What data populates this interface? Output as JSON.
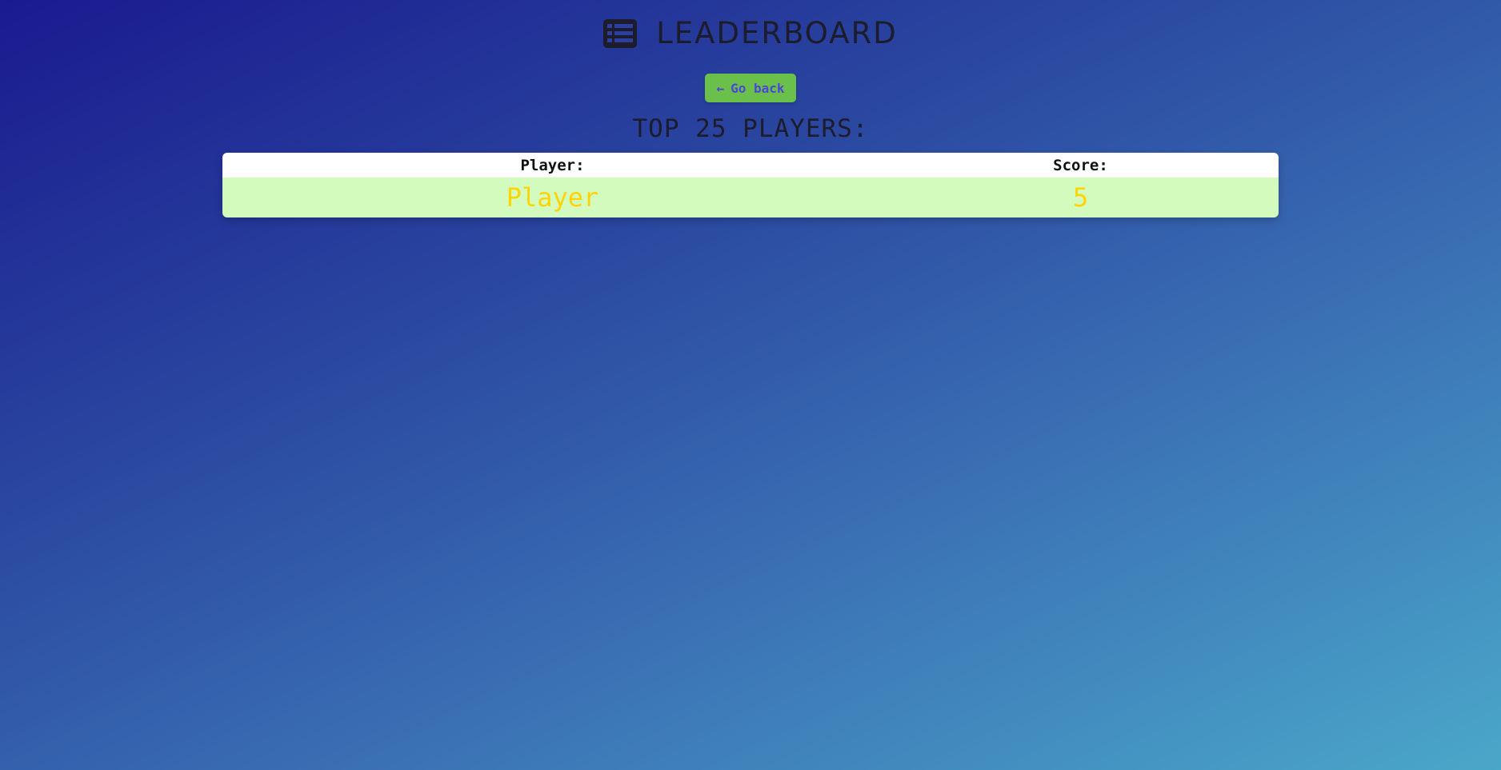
{
  "header": {
    "title": "LEADERBOARD",
    "icon": "list-icon"
  },
  "back_button": {
    "label": "Go back",
    "icon": "arrow-left-icon"
  },
  "subtitle": "TOP 25 PLAYERS:",
  "leaderboard": {
    "columns": [
      "Player:",
      "Score:"
    ],
    "rows": [
      {
        "player": "Player",
        "score": "5"
      }
    ]
  },
  "colors": {
    "button_bg": "#6ac04a",
    "button_text": "#4a46d8",
    "row_bg": "#d3fbbe",
    "row_text": "#ffd400",
    "bg_start": "#1a1a8f",
    "bg_end": "#4aa7c9"
  }
}
